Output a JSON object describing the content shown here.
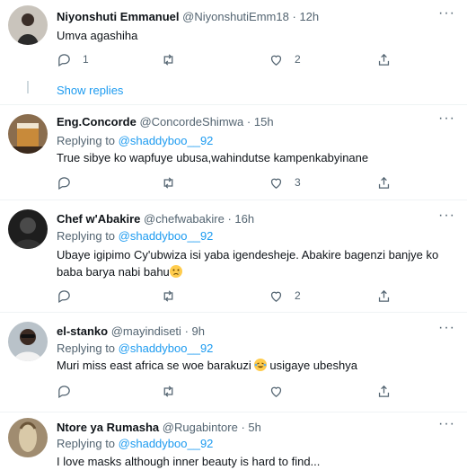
{
  "tweets": [
    {
      "name": "Niyonshuti Emmanuel",
      "handle": "@NiyonshutiEmm18",
      "time": "12h",
      "replying_to": "",
      "text": "Umva agashiha",
      "reply_count": "1",
      "retweet_count": "",
      "like_count": "2",
      "show_replies": "Show replies"
    },
    {
      "name": "Eng.Concorde",
      "handle": "@ConcordeShimwa",
      "time": "15h",
      "replying_prefix": "Replying to",
      "replying_to": "@shaddyboo__92",
      "text": "True sibye ko wapfuye ubusa,wahindutse kampenkabyinane",
      "reply_count": "",
      "retweet_count": "",
      "like_count": "3"
    },
    {
      "name": "Chef w'Abakire",
      "handle": "@chefwabakire",
      "time": "16h",
      "replying_prefix": "Replying to",
      "replying_to": "@shaddyboo__92",
      "text_line1": "Ubaye igipimo Cy'ubwiza isi yaba igendesheje. Abakire bagenzi banjye ko",
      "text_line2": "baba barya nabi bahu",
      "reply_count": "",
      "retweet_count": "",
      "like_count": "2"
    },
    {
      "name": "el-stanko",
      "handle": "@mayindiseti",
      "time": "9h",
      "replying_prefix": "Replying to",
      "replying_to": "@shaddyboo__92",
      "text_part1": "Muri miss east africa se woe barakuzi",
      "text_part2": " usigaye ubeshya",
      "reply_count": "",
      "retweet_count": "",
      "like_count": ""
    },
    {
      "name": "Ntore ya Rumasha",
      "handle": "@Rugabintore",
      "time": "5h",
      "replying_prefix": "Replying to",
      "replying_to": "@shaddyboo__92",
      "text": "I love masks although inner beauty is hard to find..."
    }
  ],
  "separator": "·",
  "colors": {
    "link": "#1d9bf0",
    "muted": "#536471",
    "text": "#0f1419",
    "divider": "#eff3f4"
  }
}
